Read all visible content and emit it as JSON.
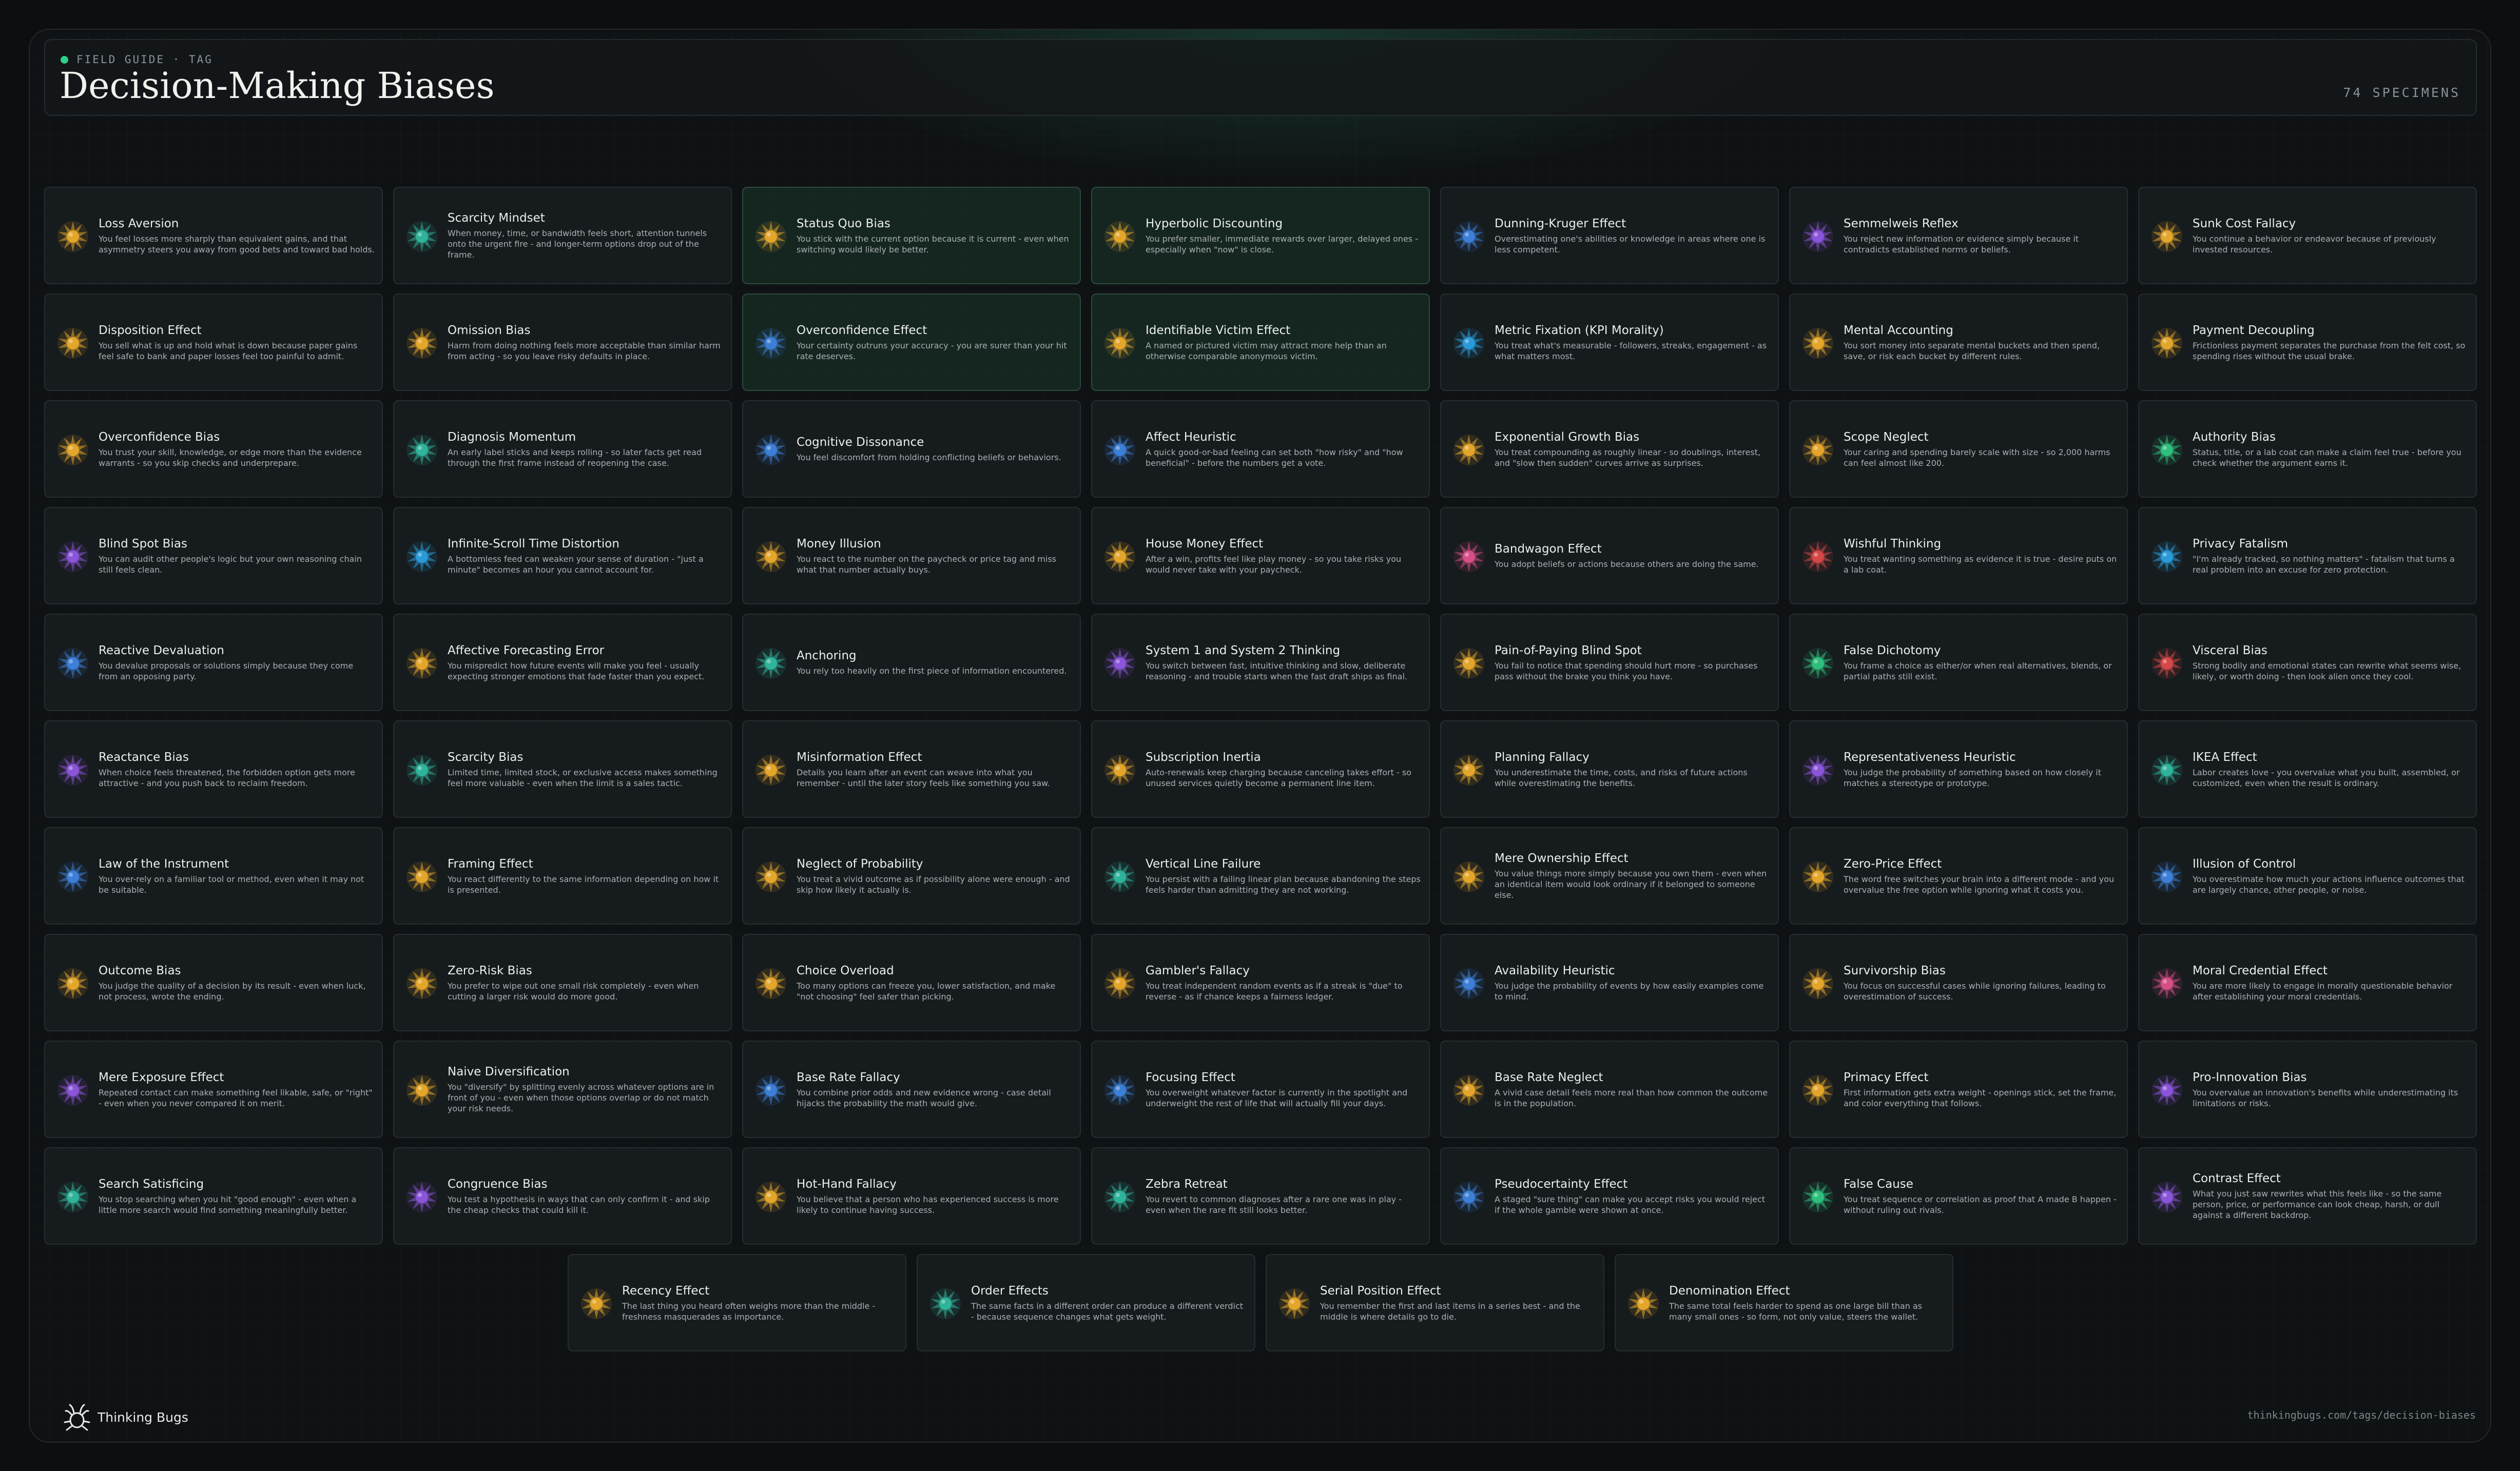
{
  "header": {
    "eyebrow": "FIELD GUIDE · TAG",
    "title": "Decision-Making Biases",
    "count": "74 SPECIMENS"
  },
  "footer": {
    "brand": "Thinking Bugs",
    "url": "thinkingbugs.com/tags/decision-biases",
    "logo_icon": "bug-icon"
  },
  "colors": {
    "accent": "#2fd088",
    "amber": "#e3a62b",
    "teal": "#2fb39a",
    "blue": "#3d7fd6",
    "purple": "#8a55d8",
    "pink": "#d64f86",
    "red": "#d44848",
    "sky": "#2a9ad8",
    "green": "#2ebf7c"
  },
  "cards": [
    {
      "name": "Loss Aversion",
      "desc": "You feel losses more sharply than equivalent gains, and that asymmetry steers you away from good bets and toward bad holds.",
      "color": "amber",
      "highlight": false
    },
    {
      "name": "Scarcity Mindset",
      "desc": "When money, time, or bandwidth feels short, attention tunnels onto the urgent fire - and longer-term options drop out of the frame.",
      "color": "teal",
      "highlight": false
    },
    {
      "name": "Status Quo Bias",
      "desc": "You stick with the current option because it is current - even when switching would likely be better.",
      "color": "amber",
      "highlight": true
    },
    {
      "name": "Hyperbolic Discounting",
      "desc": "You prefer smaller, immediate rewards over larger, delayed ones - especially when \"now\" is close.",
      "color": "amber",
      "highlight": true
    },
    {
      "name": "Dunning-Kruger Effect",
      "desc": "Overestimating one's abilities or knowledge in areas where one is less competent.",
      "color": "blue",
      "highlight": false
    },
    {
      "name": "Semmelweis Reflex",
      "desc": "You reject new information or evidence simply because it contradicts established norms or beliefs.",
      "color": "purple",
      "highlight": false
    },
    {
      "name": "Sunk Cost Fallacy",
      "desc": "You continue a behavior or endeavor because of previously invested resources.",
      "color": "amber",
      "highlight": false
    },
    {
      "name": "Disposition Effect",
      "desc": "You sell what is up and hold what is down because paper gains feel safe to bank and paper losses feel too painful to admit.",
      "color": "amber",
      "highlight": false
    },
    {
      "name": "Omission Bias",
      "desc": "Harm from doing nothing feels more acceptable than similar harm from acting - so you leave risky defaults in place.",
      "color": "amber",
      "highlight": false
    },
    {
      "name": "Overconfidence Effect",
      "desc": "Your certainty outruns your accuracy - you are surer than your hit rate deserves.",
      "color": "blue",
      "highlight": true
    },
    {
      "name": "Identifiable Victim Effect",
      "desc": "A named or pictured victim may attract more help than an otherwise comparable anonymous victim.",
      "color": "amber",
      "highlight": true
    },
    {
      "name": "Metric Fixation (KPI Morality)",
      "desc": "You treat what's measurable - followers, streaks, engagement - as what matters most.",
      "color": "sky",
      "highlight": false
    },
    {
      "name": "Mental Accounting",
      "desc": "You sort money into separate mental buckets and then spend, save, or risk each bucket by different rules.",
      "color": "amber",
      "highlight": false
    },
    {
      "name": "Payment Decoupling",
      "desc": "Frictionless payment separates the purchase from the felt cost, so spending rises without the usual brake.",
      "color": "amber",
      "highlight": false
    },
    {
      "name": "Overconfidence Bias",
      "desc": "You trust your skill, knowledge, or edge more than the evidence warrants - so you skip checks and underprepare.",
      "color": "amber",
      "highlight": false
    },
    {
      "name": "Diagnosis Momentum",
      "desc": "An early label sticks and keeps rolling - so later facts get read through the first frame instead of reopening the case.",
      "color": "teal",
      "highlight": false
    },
    {
      "name": "Cognitive Dissonance",
      "desc": "You feel discomfort from holding conflicting beliefs or behaviors.",
      "color": "blue",
      "highlight": false
    },
    {
      "name": "Affect Heuristic",
      "desc": "A quick good-or-bad feeling can set both \"how risky\" and \"how beneficial\" - before the numbers get a vote.",
      "color": "blue",
      "highlight": false
    },
    {
      "name": "Exponential Growth Bias",
      "desc": "You treat compounding as roughly linear - so doublings, interest, and \"slow then sudden\" curves arrive as surprises.",
      "color": "amber",
      "highlight": false
    },
    {
      "name": "Scope Neglect",
      "desc": "Your caring and spending barely scale with size - so 2,000 harms can feel almost like 200.",
      "color": "amber",
      "highlight": false
    },
    {
      "name": "Authority Bias",
      "desc": "Status, title, or a lab coat can make a claim feel true - before you check whether the argument earns it.",
      "color": "green",
      "highlight": false
    },
    {
      "name": "Blind Spot Bias",
      "desc": "You can audit other people's logic but your own reasoning chain still feels clean.",
      "color": "purple",
      "highlight": false
    },
    {
      "name": "Infinite-Scroll Time Distortion",
      "desc": "A bottomless feed can weaken your sense of duration - \"just a minute\" becomes an hour you cannot account for.",
      "color": "sky",
      "highlight": false
    },
    {
      "name": "Money Illusion",
      "desc": "You react to the number on the paycheck or price tag and miss what that number actually buys.",
      "color": "amber",
      "highlight": false
    },
    {
      "name": "House Money Effect",
      "desc": "After a win, profits feel like play money - so you take risks you would never take with your paycheck.",
      "color": "amber",
      "highlight": false
    },
    {
      "name": "Bandwagon Effect",
      "desc": "You adopt beliefs or actions because others are doing the same.",
      "color": "pink",
      "highlight": false
    },
    {
      "name": "Wishful Thinking",
      "desc": "You treat wanting something as evidence it is true - desire puts on a lab coat.",
      "color": "red",
      "highlight": false
    },
    {
      "name": "Privacy Fatalism",
      "desc": "\"I'm already tracked, so nothing matters\" - fatalism that turns a real problem into an excuse for zero protection.",
      "color": "sky",
      "highlight": false
    },
    {
      "name": "Reactive Devaluation",
      "desc": "You devalue proposals or solutions simply because they come from an opposing party.",
      "color": "blue",
      "highlight": false
    },
    {
      "name": "Affective Forecasting Error",
      "desc": "You mispredict how future events will make you feel - usually expecting stronger emotions that fade faster than you expect.",
      "color": "amber",
      "highlight": false
    },
    {
      "name": "Anchoring",
      "desc": "You rely too heavily on the first piece of information encountered.",
      "color": "teal",
      "highlight": false
    },
    {
      "name": "System 1 and System 2 Thinking",
      "desc": "You switch between fast, intuitive thinking and slow, deliberate reasoning - and trouble starts when the fast draft ships as final.",
      "color": "purple",
      "highlight": false
    },
    {
      "name": "Pain-of-Paying Blind Spot",
      "desc": "You fail to notice that spending should hurt more - so purchases pass without the brake you think you have.",
      "color": "amber",
      "highlight": false
    },
    {
      "name": "False Dichotomy",
      "desc": "You frame a choice as either/or when real alternatives, blends, or partial paths still exist.",
      "color": "green",
      "highlight": false
    },
    {
      "name": "Visceral Bias",
      "desc": "Strong bodily and emotional states can rewrite what seems wise, likely, or worth doing - then look alien once they cool.",
      "color": "red",
      "highlight": false
    },
    {
      "name": "Reactance Bias",
      "desc": "When choice feels threatened, the forbidden option gets more attractive - and you push back to reclaim freedom.",
      "color": "purple",
      "highlight": false
    },
    {
      "name": "Scarcity Bias",
      "desc": "Limited time, limited stock, or exclusive access makes something feel more valuable - even when the limit is a sales tactic.",
      "color": "teal",
      "highlight": false
    },
    {
      "name": "Misinformation Effect",
      "desc": "Details you learn after an event can weave into what you remember - until the later story feels like something you saw.",
      "color": "amber",
      "highlight": false
    },
    {
      "name": "Subscription Inertia",
      "desc": "Auto-renewals keep charging because canceling takes effort - so unused services quietly become a permanent line item.",
      "color": "amber",
      "highlight": false
    },
    {
      "name": "Planning Fallacy",
      "desc": "You underestimate the time, costs, and risks of future actions while overestimating the benefits.",
      "color": "amber",
      "highlight": false
    },
    {
      "name": "Representativeness Heuristic",
      "desc": "You judge the probability of something based on how closely it matches a stereotype or prototype.",
      "color": "purple",
      "highlight": false
    },
    {
      "name": "IKEA Effect",
      "desc": "Labor creates love - you overvalue what you built, assembled, or customized, even when the result is ordinary.",
      "color": "teal",
      "highlight": false
    },
    {
      "name": "Law of the Instrument",
      "desc": "You over-rely on a familiar tool or method, even when it may not be suitable.",
      "color": "blue",
      "highlight": false
    },
    {
      "name": "Framing Effect",
      "desc": "You react differently to the same information depending on how it is presented.",
      "color": "amber",
      "highlight": false
    },
    {
      "name": "Neglect of Probability",
      "desc": "You treat a vivid outcome as if possibility alone were enough - and skip how likely it actually is.",
      "color": "amber",
      "highlight": false
    },
    {
      "name": "Vertical Line Failure",
      "desc": "You persist with a failing linear plan because abandoning the steps feels harder than admitting they are not working.",
      "color": "teal",
      "highlight": false
    },
    {
      "name": "Mere Ownership Effect",
      "desc": "You value things more simply because you own them - even when an identical item would look ordinary if it belonged to someone else.",
      "color": "amber",
      "highlight": false
    },
    {
      "name": "Zero-Price Effect",
      "desc": "The word free switches your brain into a different mode - and you overvalue the free option while ignoring what it costs you.",
      "color": "amber",
      "highlight": false
    },
    {
      "name": "Illusion of Control",
      "desc": "You overestimate how much your actions influence outcomes that are largely chance, other people, or noise.",
      "color": "blue",
      "highlight": false
    },
    {
      "name": "Outcome Bias",
      "desc": "You judge the quality of a decision by its result - even when luck, not process, wrote the ending.",
      "color": "amber",
      "highlight": false
    },
    {
      "name": "Zero-Risk Bias",
      "desc": "You prefer to wipe out one small risk completely - even when cutting a larger risk would do more good.",
      "color": "amber",
      "highlight": false
    },
    {
      "name": "Choice Overload",
      "desc": "Too many options can freeze you, lower satisfaction, and make \"not choosing\" feel safer than picking.",
      "color": "amber",
      "highlight": false
    },
    {
      "name": "Gambler's Fallacy",
      "desc": "You treat independent random events as if a streak is \"due\" to reverse - as if chance keeps a fairness ledger.",
      "color": "amber",
      "highlight": false
    },
    {
      "name": "Availability Heuristic",
      "desc": "You judge the probability of events by how easily examples come to mind.",
      "color": "blue",
      "highlight": false
    },
    {
      "name": "Survivorship Bias",
      "desc": "You focus on successful cases while ignoring failures, leading to overestimation of success.",
      "color": "amber",
      "highlight": false
    },
    {
      "name": "Moral Credential Effect",
      "desc": "You are more likely to engage in morally questionable behavior after establishing your moral credentials.",
      "color": "pink",
      "highlight": false
    },
    {
      "name": "Mere Exposure Effect",
      "desc": "Repeated contact can make something feel likable, safe, or \"right\" - even when you never compared it on merit.",
      "color": "purple",
      "highlight": false
    },
    {
      "name": "Naive Diversification",
      "desc": "You \"diversify\" by splitting evenly across whatever options are in front of you - even when those options overlap or do not match your risk needs.",
      "color": "amber",
      "highlight": false
    },
    {
      "name": "Base Rate Fallacy",
      "desc": "You combine prior odds and new evidence wrong - case detail hijacks the probability the math would give.",
      "color": "blue",
      "highlight": false
    },
    {
      "name": "Focusing Effect",
      "desc": "You overweight whatever factor is currently in the spotlight and underweight the rest of life that will actually fill your days.",
      "color": "blue",
      "highlight": false
    },
    {
      "name": "Base Rate Neglect",
      "desc": "A vivid case detail feels more real than how common the outcome is in the population.",
      "color": "amber",
      "highlight": false
    },
    {
      "name": "Primacy Effect",
      "desc": "First information gets extra weight - openings stick, set the frame, and color everything that follows.",
      "color": "amber",
      "highlight": false
    },
    {
      "name": "Pro-Innovation Bias",
      "desc": "You overvalue an innovation's benefits while underestimating its limitations or risks.",
      "color": "purple",
      "highlight": false
    },
    {
      "name": "Search Satisficing",
      "desc": "You stop searching when you hit \"good enough\" - even when a little more search would find something meaningfully better.",
      "color": "teal",
      "highlight": false
    },
    {
      "name": "Congruence Bias",
      "desc": "You test a hypothesis in ways that can only confirm it - and skip the cheap checks that could kill it.",
      "color": "purple",
      "highlight": false
    },
    {
      "name": "Hot-Hand Fallacy",
      "desc": "You believe that a person who has experienced success is more likely to continue having success.",
      "color": "amber",
      "highlight": false
    },
    {
      "name": "Zebra Retreat",
      "desc": "You revert to common diagnoses after a rare one was in play - even when the rare fit still looks better.",
      "color": "teal",
      "highlight": false
    },
    {
      "name": "Pseudocertainty Effect",
      "desc": "A staged \"sure thing\" can make you accept risks you would reject if the whole gamble were shown at once.",
      "color": "blue",
      "highlight": false
    },
    {
      "name": "False Cause",
      "desc": "You treat sequence or correlation as proof that A made B happen - without ruling out rivals.",
      "color": "green",
      "highlight": false
    },
    {
      "name": "Contrast Effect",
      "desc": "What you just saw rewrites what this feels like - so the same person, price, or performance can look cheap, harsh, or dull against a different backdrop.",
      "color": "purple",
      "highlight": false
    },
    {
      "name": "Recency Effect",
      "desc": "The last thing you heard often weighs more than the middle - freshness masquerades as importance.",
      "color": "amber",
      "highlight": false
    },
    {
      "name": "Order Effects",
      "desc": "The same facts in a different order can produce a different verdict - because sequence changes what gets weight.",
      "color": "teal",
      "highlight": false
    },
    {
      "name": "Serial Position Effect",
      "desc": "You remember the first and last items in a series best - and the middle is where details go to die.",
      "color": "amber",
      "highlight": false
    },
    {
      "name": "Denomination Effect",
      "desc": "The same total feels harder to spend as one large bill than as many small ones - so form, not only value, steers the wallet.",
      "color": "amber",
      "highlight": false
    }
  ]
}
